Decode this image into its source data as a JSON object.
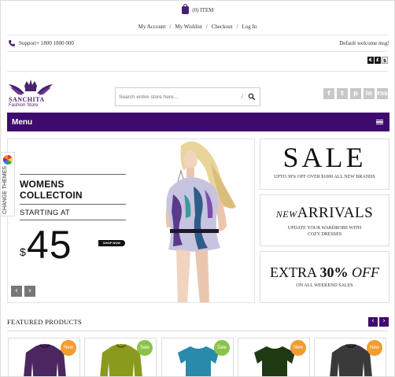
{
  "header": {
    "cart_text": "(0) ITEM",
    "account_links": [
      "My Account",
      "My Wishlist",
      "Checkout",
      "Log In"
    ],
    "separator": "/",
    "support_text": "Support+ 1800 1800 000",
    "welcome_text": "Default welcome msg!",
    "currency": [
      "€",
      "£",
      "$"
    ]
  },
  "logo": {
    "name": "SANCHITA",
    "tagline": "Fashion Store"
  },
  "search": {
    "placeholder": "Search entire store here...",
    "slash": "/"
  },
  "social": [
    "f",
    "t",
    "p",
    "in",
    "rss"
  ],
  "menu": {
    "label": "Menu"
  },
  "slider": {
    "heading": "WOMENS COLLECTOIN",
    "subheading": "STARTING AT",
    "currency": "$",
    "price": "45",
    "button": "SHOP NOW",
    "prev": "‹",
    "next": "›"
  },
  "side_tab": {
    "label": "CHANGE THEMES"
  },
  "promos": {
    "sale": {
      "title": "SALE",
      "text": "UPTO 30% OFF OVER $1000  ALL NEW BRANDS"
    },
    "arrivals": {
      "title_em": "NEW",
      "title": "ARRIVALS",
      "line1": "UPDATE  YOUR WARDROBE WITH",
      "line2": "COZY DRESSES"
    },
    "extra": {
      "title_a": "EXTRA",
      "title_b": "30%",
      "title_c": "OFF",
      "text": "ON ALL WEEKEND SALES"
    }
  },
  "featured": {
    "title": "FEATURED PRODUCTS",
    "prev": "‹",
    "next": "›",
    "products": [
      {
        "badge": "New",
        "color": "#4b2660"
      },
      {
        "badge": "Sale",
        "color": "#8a9a1c"
      },
      {
        "badge": "Sale",
        "color": "#2a8aab"
      },
      {
        "badge": "New",
        "color": "#1f3a12"
      },
      {
        "badge": "New",
        "color": "#3a3a3a"
      }
    ]
  },
  "colors": {
    "brand": "#3e0a6e",
    "badge_new": "#f39c2f",
    "badge_sale": "#8bc34a"
  }
}
